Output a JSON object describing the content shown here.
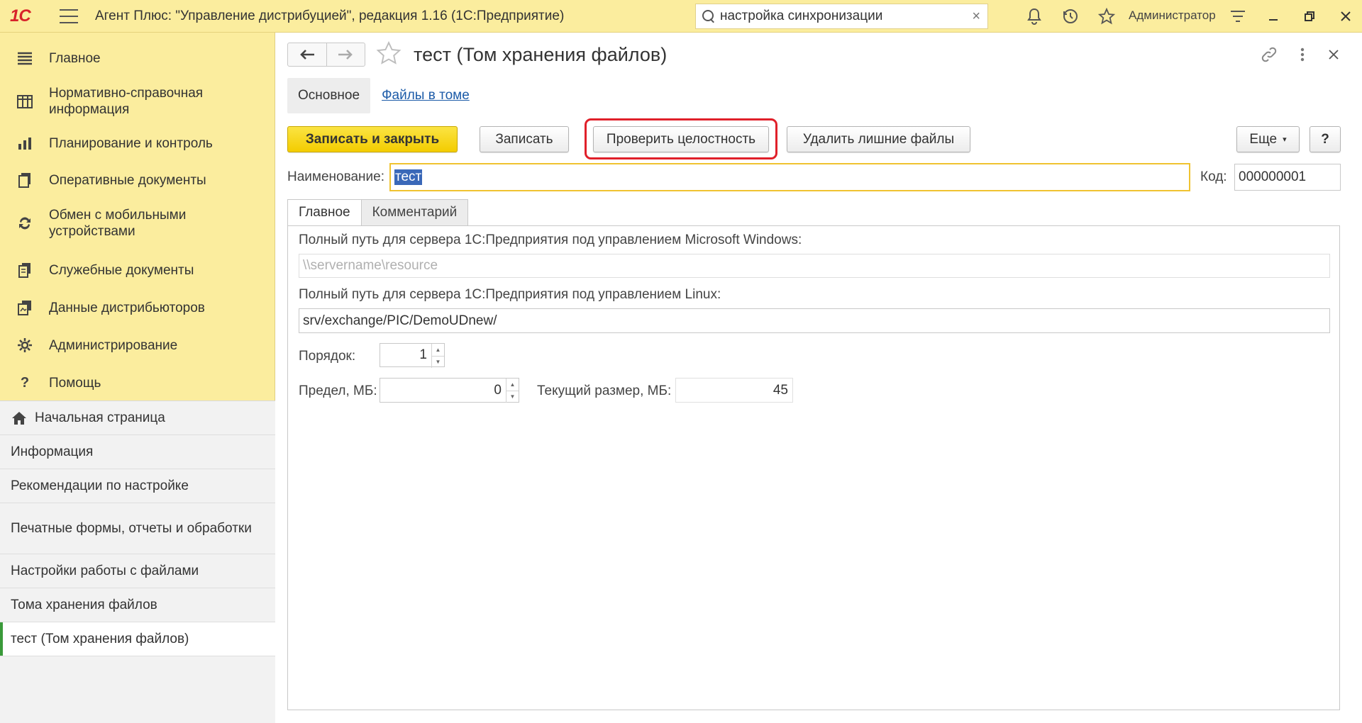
{
  "titlebar": {
    "logo": "1С",
    "app_title": "Агент Плюс: \"Управление дистрибуцией\", редакция 1.16  (1С:Предприятие)",
    "search_value": "настройка синхронизации",
    "search_clear": "×",
    "user": "Администратор",
    "icons": [
      "bell-icon",
      "history-icon",
      "star-icon",
      "settings-menu-icon"
    ]
  },
  "sidebar": {
    "sections": [
      {
        "label": "Главное",
        "icon": "list-icon"
      },
      {
        "label": "Нормативно-справочная информация",
        "icon": "catalog-icon"
      },
      {
        "label": "Планирование и контроль",
        "icon": "chart-icon"
      },
      {
        "label": "Оперативные документы",
        "icon": "documents-icon"
      },
      {
        "label": "Обмен с мобильными устройствами",
        "icon": "sync-icon"
      },
      {
        "label": "Служебные документы",
        "icon": "service-docs-icon"
      },
      {
        "label": "Данные дистрибьюторов",
        "icon": "distributor-data-icon"
      },
      {
        "label": "Администрирование",
        "icon": "gear-icon"
      },
      {
        "label": "Помощь",
        "icon": "help-icon"
      }
    ],
    "open_windows": [
      {
        "label": "Начальная страница"
      },
      {
        "label": "Информация"
      },
      {
        "label": "Рекомендации по настройке"
      },
      {
        "label": "Печатные формы, отчеты и обработки"
      },
      {
        "label": "Настройки работы с файлами"
      },
      {
        "label": "Тома хранения файлов"
      },
      {
        "label": "тест (Том хранения файлов)"
      }
    ]
  },
  "form": {
    "title": "тест (Том хранения файлов)",
    "tabs": {
      "main": "Основное",
      "files": "Файлы в томе"
    },
    "buttons": {
      "save_close": "Записать и закрыть",
      "save": "Записать",
      "check_integrity": "Проверить целостность",
      "delete_extra": "Удалить лишние файлы",
      "more": "Еще",
      "help": "?"
    },
    "name_label": "Наименование:",
    "name_value": "тест",
    "code_label": "Код:",
    "code_value": "000000001",
    "inner_tabs": {
      "main": "Главное",
      "comment": "Комментарий"
    },
    "windows_path_label": "Полный путь для сервера 1С:Предприятия под управлением Microsoft Windows:",
    "windows_path_placeholder": "\\\\servername\\resource",
    "linux_path_label": "Полный путь для сервера 1С:Предприятия под управлением Linux:",
    "linux_path_value": "srv/exchange/PIC/DemoUDnew/",
    "order_label": "Порядок:",
    "order_value": "1",
    "limit_label": "Предел, МБ:",
    "limit_value": "0",
    "current_size_label": "Текущий размер, МБ:",
    "current_size_value": "45"
  }
}
